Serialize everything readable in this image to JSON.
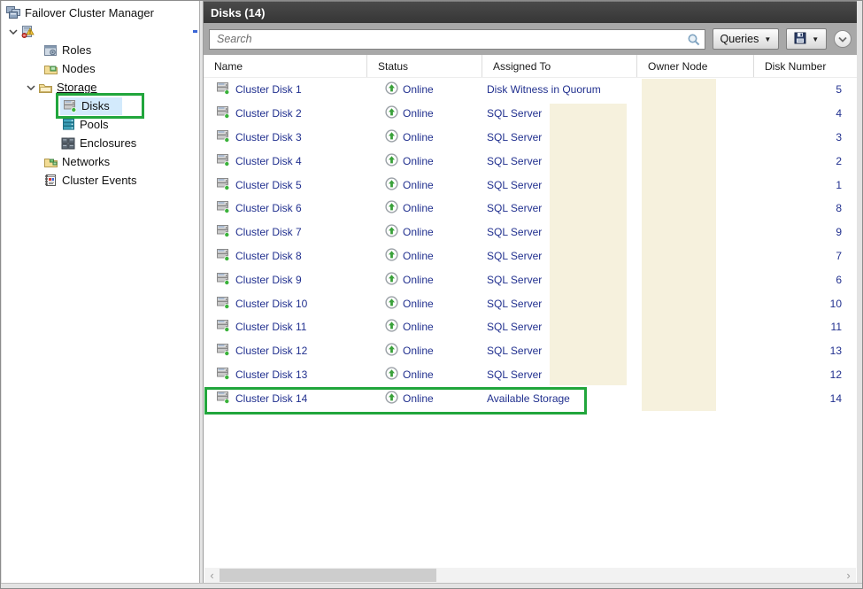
{
  "sidebar": {
    "root_label": "Failover Cluster Manager",
    "cluster_node_label": "",
    "items": [
      {
        "label": "Roles"
      },
      {
        "label": "Nodes"
      },
      {
        "label": "Storage"
      },
      {
        "label": "Disks"
      },
      {
        "label": "Pools"
      },
      {
        "label": "Enclosures"
      },
      {
        "label": "Networks"
      },
      {
        "label": "Cluster Events"
      }
    ]
  },
  "main": {
    "header": {
      "title": "Disks (14)"
    },
    "toolbar": {
      "search_placeholder": "Search",
      "queries_label": "Queries"
    },
    "table": {
      "columns": [
        "Name",
        "Status",
        "Assigned To",
        "Owner Node",
        "Disk Number"
      ],
      "rows": [
        {
          "name": "Cluster Disk 1",
          "status": "Online",
          "assigned_to": "Disk Witness in Quorum",
          "owner_node": "",
          "disk_number": "5"
        },
        {
          "name": "Cluster Disk 2",
          "status": "Online",
          "assigned_to": "SQL Server",
          "owner_node": "",
          "disk_number": "4"
        },
        {
          "name": "Cluster Disk 3",
          "status": "Online",
          "assigned_to": "SQL Server",
          "owner_node": "",
          "disk_number": "3"
        },
        {
          "name": "Cluster Disk 4",
          "status": "Online",
          "assigned_to": "SQL Server",
          "owner_node": "",
          "disk_number": "2"
        },
        {
          "name": "Cluster Disk 5",
          "status": "Online",
          "assigned_to": "SQL Server",
          "owner_node": "",
          "disk_number": "1"
        },
        {
          "name": "Cluster Disk 6",
          "status": "Online",
          "assigned_to": "SQL Server",
          "owner_node": "",
          "disk_number": "8"
        },
        {
          "name": "Cluster Disk 7",
          "status": "Online",
          "assigned_to": "SQL Server",
          "owner_node": "",
          "disk_number": "9"
        },
        {
          "name": "Cluster Disk 8",
          "status": "Online",
          "assigned_to": "SQL Server",
          "owner_node": "",
          "disk_number": "7"
        },
        {
          "name": "Cluster Disk 9",
          "status": "Online",
          "assigned_to": "SQL Server",
          "owner_node": "",
          "disk_number": "6"
        },
        {
          "name": "Cluster Disk 10",
          "status": "Online",
          "assigned_to": "SQL Server",
          "owner_node": "",
          "disk_number": "10"
        },
        {
          "name": "Cluster Disk 11",
          "status": "Online",
          "assigned_to": "SQL Server",
          "owner_node": "",
          "disk_number": "11"
        },
        {
          "name": "Cluster Disk 12",
          "status": "Online",
          "assigned_to": "SQL Server",
          "owner_node": "",
          "disk_number": "13"
        },
        {
          "name": "Cluster Disk 13",
          "status": "Online",
          "assigned_to": "SQL Server",
          "owner_node": "",
          "disk_number": "12"
        },
        {
          "name": "Cluster Disk 14",
          "status": "Online",
          "assigned_to": "Available Storage",
          "owner_node": "",
          "disk_number": "14"
        }
      ]
    }
  },
  "icons": {
    "tree_chevron_expanded": "⌄",
    "dropdown_arrow": "▼",
    "scroll_left_arrow": "‹",
    "scroll_right_arrow": "›"
  },
  "colors": {
    "annotation_green": "#21a63c",
    "redaction_beige": "#f6f1dd",
    "row_text_navy": "#21308f",
    "status_green": "#3aa13a",
    "panel_header_dark": "#3b3b3b",
    "selection_blue": "#d3eafc"
  }
}
